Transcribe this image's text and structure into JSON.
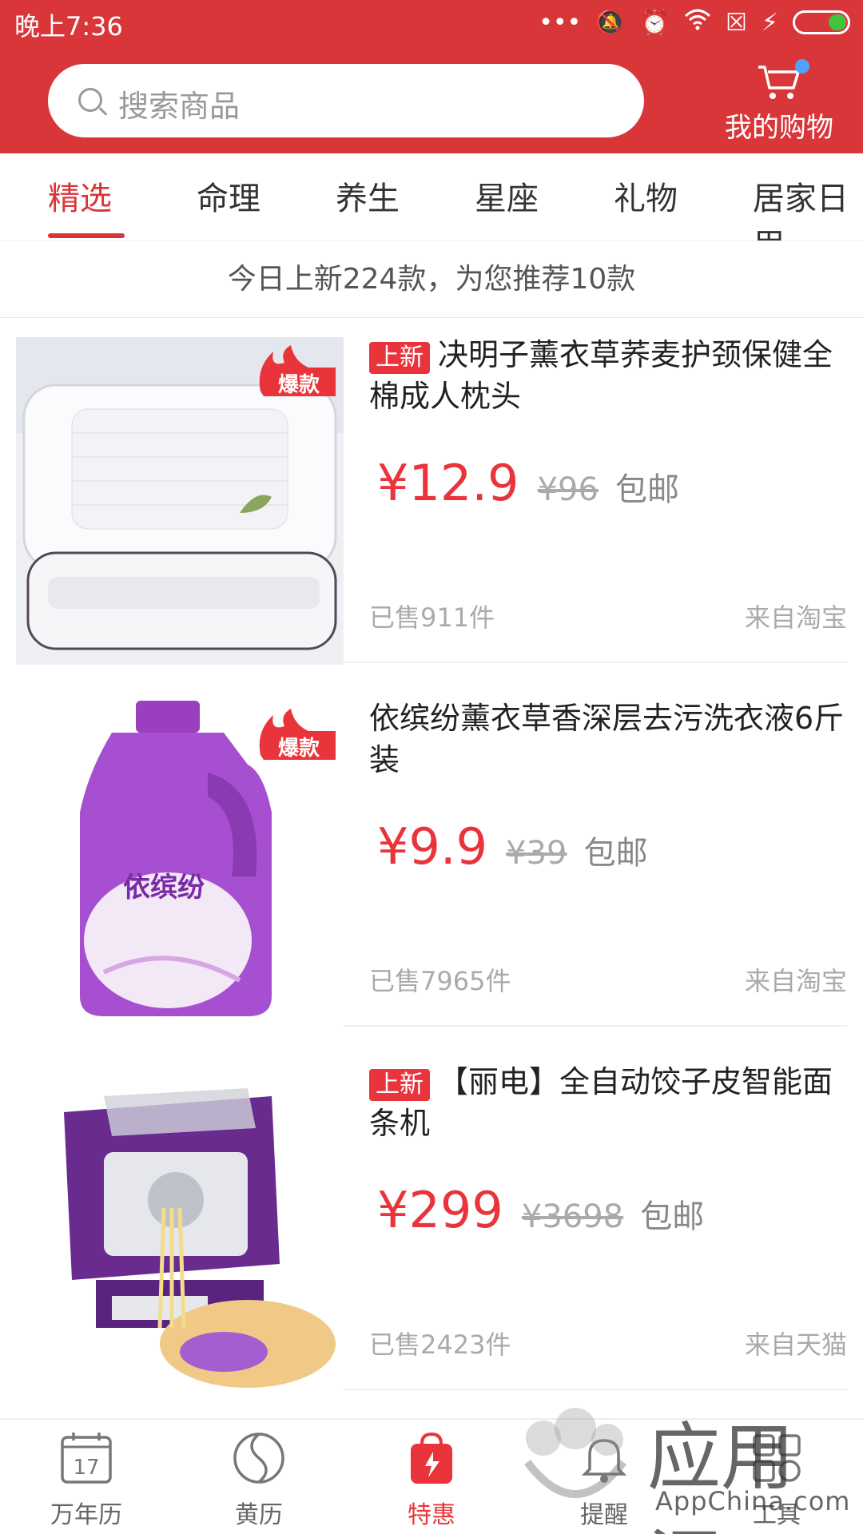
{
  "status": {
    "time": "晚上7:36"
  },
  "search": {
    "placeholder": "搜索商品"
  },
  "cart": {
    "label": "我的购物"
  },
  "tabs": [
    "精选",
    "命理",
    "养生",
    "星座",
    "礼物",
    "居家日用"
  ],
  "banner": "今日上新224款，为您推荐10款",
  "products": [
    {
      "badge": "上新",
      "hot": "爆款",
      "title": "决明子薰衣草荞麦护颈保健全棉成人枕头",
      "price": "¥12.9",
      "old_price": "¥96",
      "shipping": "包邮",
      "sold": "已售911件",
      "source": "来自淘宝"
    },
    {
      "badge": "",
      "hot": "爆款",
      "product_text": "依缤纷",
      "title": "依缤纷薰衣草香深层去污洗衣液6斤装",
      "price": "¥9.9",
      "old_price": "¥39",
      "shipping": "包邮",
      "sold": "已售7965件",
      "source": "来自淘宝"
    },
    {
      "badge": "上新",
      "title": "【丽电】全自动饺子皮智能面条机",
      "price": "¥299",
      "old_price": "¥3698",
      "shipping": "包邮",
      "sold": "已售2423件",
      "source": "来自天猫"
    }
  ],
  "bottom_nav": [
    {
      "label": "万年历",
      "icon": "calendar-icon",
      "date": "17"
    },
    {
      "label": "黄历",
      "icon": "almanac-icon"
    },
    {
      "label": "特惠",
      "icon": "shopping-bag-icon"
    },
    {
      "label": "提醒",
      "icon": "bell-icon"
    },
    {
      "label": "工具",
      "icon": "tools-icon"
    }
  ],
  "watermark": {
    "text": "应用汇",
    "subtext": "AppChina.com"
  },
  "colors": {
    "primary": "#d9363a",
    "price": "#e9343b",
    "active_nav": "#e9343b"
  }
}
